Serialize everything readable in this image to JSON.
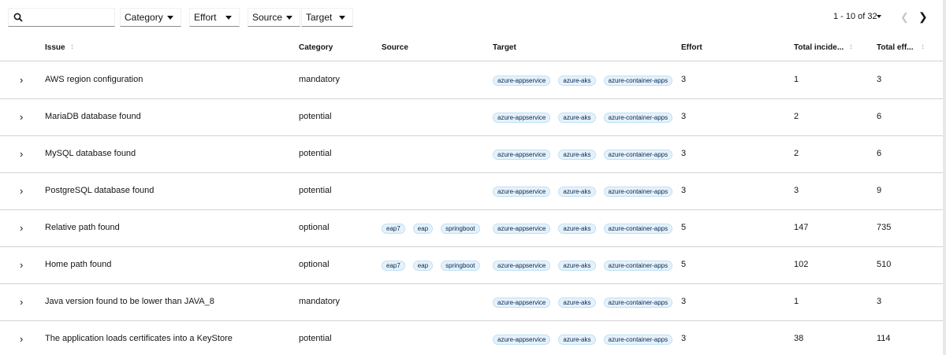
{
  "toolbar": {
    "search_value": "",
    "filters": [
      {
        "label": "Category"
      },
      {
        "label": "Effort"
      },
      {
        "label": "Source"
      },
      {
        "label": "Target"
      }
    ],
    "pagination": {
      "text": "1 - 10 of 32",
      "prev_icon": "chevron-left-icon",
      "next_icon": "chevron-right-icon"
    }
  },
  "table": {
    "columns": [
      "Issue",
      "Category",
      "Source",
      "Target",
      "Effort",
      "Total incide...",
      "Total eff..."
    ],
    "rows": [
      {
        "issue": "AWS region configuration",
        "category": "mandatory",
        "source": [],
        "target": [
          "azure-appservice",
          "azure-aks",
          "azure-container-apps"
        ],
        "effort": "3",
        "incidents": "1",
        "total_effort": "3"
      },
      {
        "issue": "MariaDB database found",
        "category": "potential",
        "source": [],
        "target": [
          "azure-appservice",
          "azure-aks",
          "azure-container-apps"
        ],
        "effort": "3",
        "incidents": "2",
        "total_effort": "6"
      },
      {
        "issue": "MySQL database found",
        "category": "potential",
        "source": [],
        "target": [
          "azure-appservice",
          "azure-aks",
          "azure-container-apps"
        ],
        "effort": "3",
        "incidents": "2",
        "total_effort": "6"
      },
      {
        "issue": "PostgreSQL database found",
        "category": "potential",
        "source": [],
        "target": [
          "azure-appservice",
          "azure-aks",
          "azure-container-apps"
        ],
        "effort": "3",
        "incidents": "3",
        "total_effort": "9"
      },
      {
        "issue": "Relative path found",
        "category": "optional",
        "source": [
          "eap7",
          "eap",
          "springboot"
        ],
        "target": [
          "azure-appservice",
          "azure-aks",
          "azure-container-apps"
        ],
        "effort": "5",
        "incidents": "147",
        "total_effort": "735"
      },
      {
        "issue": "Home path found",
        "category": "optional",
        "source": [
          "eap7",
          "eap",
          "springboot"
        ],
        "target": [
          "azure-appservice",
          "azure-aks",
          "azure-container-apps"
        ],
        "effort": "5",
        "incidents": "102",
        "total_effort": "510"
      },
      {
        "issue": "Java version found to be lower than JAVA_8",
        "category": "mandatory",
        "source": [],
        "target": [
          "azure-appservice",
          "azure-aks",
          "azure-container-apps"
        ],
        "effort": "3",
        "incidents": "1",
        "total_effort": "3"
      },
      {
        "issue": "The application loads certificates into a KeyStore",
        "category": "potential",
        "source": [],
        "target": [
          "azure-appservice",
          "azure-aks",
          "azure-container-apps"
        ],
        "effort": "3",
        "incidents": "38",
        "total_effort": "114"
      }
    ]
  }
}
